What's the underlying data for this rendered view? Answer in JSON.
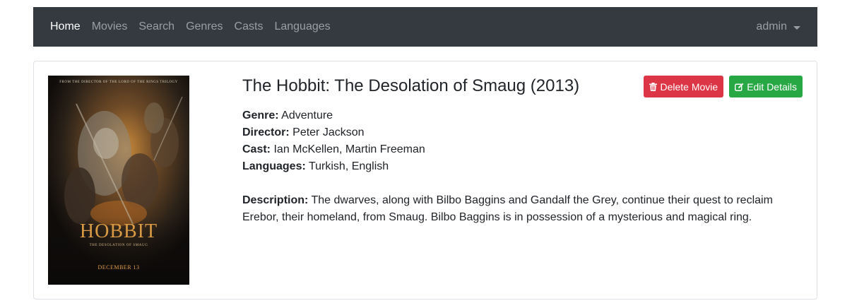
{
  "nav": {
    "items": [
      "Home",
      "Movies",
      "Search",
      "Genres",
      "Casts",
      "Languages"
    ],
    "active": "Home",
    "user": "admin"
  },
  "movie": {
    "title": "The Hobbit: The Desolation of Smaug (2013)",
    "genre_label": "Genre:",
    "genre": "Adventure",
    "director_label": "Director:",
    "director": "Peter Jackson",
    "cast_label": "Cast:",
    "cast": "Ian McKellen, Martin Freeman",
    "languages_label": "Languages:",
    "languages": "Turkish, English",
    "description_label": "Description:",
    "description": "The dwarves, along with Bilbo Baggins and Gandalf the Grey, continue their quest to reclaim Erebor, their homeland, from Smaug. Bilbo Baggins is in possession of a mysterious and magical ring."
  },
  "actions": {
    "delete_label": "Delete Movie",
    "edit_label": "Edit Details"
  },
  "poster": {
    "tagline": "FROM THE DIRECTOR OF THE LORD OF THE RINGS TRILOGY",
    "logo": "HOBBIT",
    "subtitle": "THE DESOLATION OF SMAUG",
    "date": "DECEMBER 13"
  },
  "colors": {
    "navbar": "#343a40",
    "danger": "#dc3545",
    "success": "#28a745"
  }
}
